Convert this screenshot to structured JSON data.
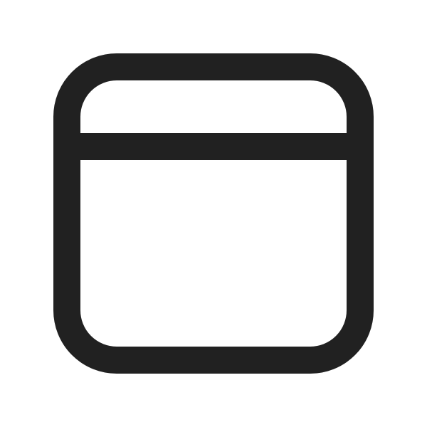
{
  "icon": {
    "name": "app-window-icon",
    "stroke_color": "#212121",
    "background_color": "#ffffff"
  }
}
